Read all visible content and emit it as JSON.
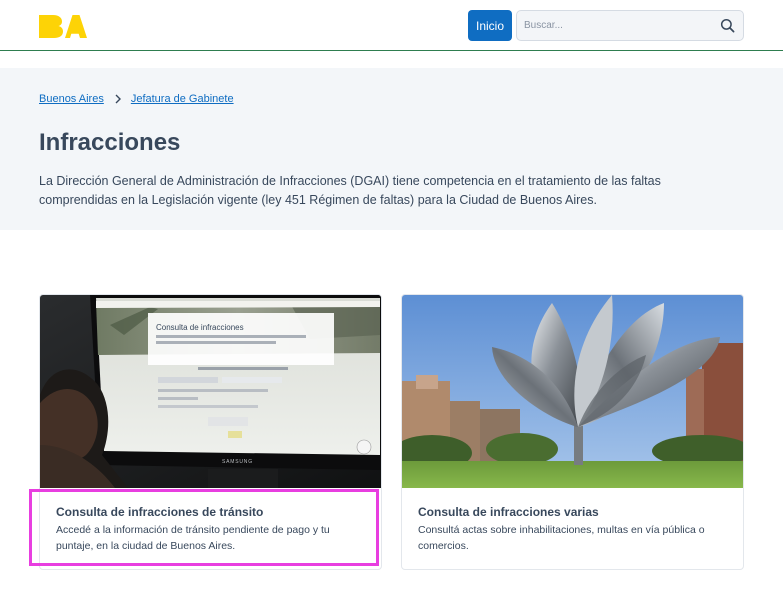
{
  "header": {
    "home_button": "Inicio",
    "search_placeholder": "Buscar..."
  },
  "breadcrumb": [
    "Buenos Aires",
    "Jefatura de Gabinete"
  ],
  "page": {
    "title": "Infracciones",
    "description": "La Dirección General de Administración de Infracciones (DGAI) tiene competencia en el tratamiento de las faltas comprendidas en la Legislación vigente (ley 451 Régimen de faltas) para la Ciudad de Buenos Aires."
  },
  "cards": [
    {
      "title": "Consulta de infracciones de tránsito",
      "text": "Accedé a la información de tránsito pendiente de pago y tu puntaje, en la ciudad de Buenos Aires.",
      "image_title": "Consulta de infracciones",
      "image_brand": "SAMSUNG"
    },
    {
      "title": "Consulta de infracciones varias",
      "text": "Consultá actas sobre inhabilitaciones, multas en vía pública o comercios."
    }
  ],
  "colors": {
    "brand_yellow": "#fdd306",
    "primary_blue": "#0f6dc2",
    "header_line": "#2e7d4f",
    "highlight": "#e83ee0"
  }
}
